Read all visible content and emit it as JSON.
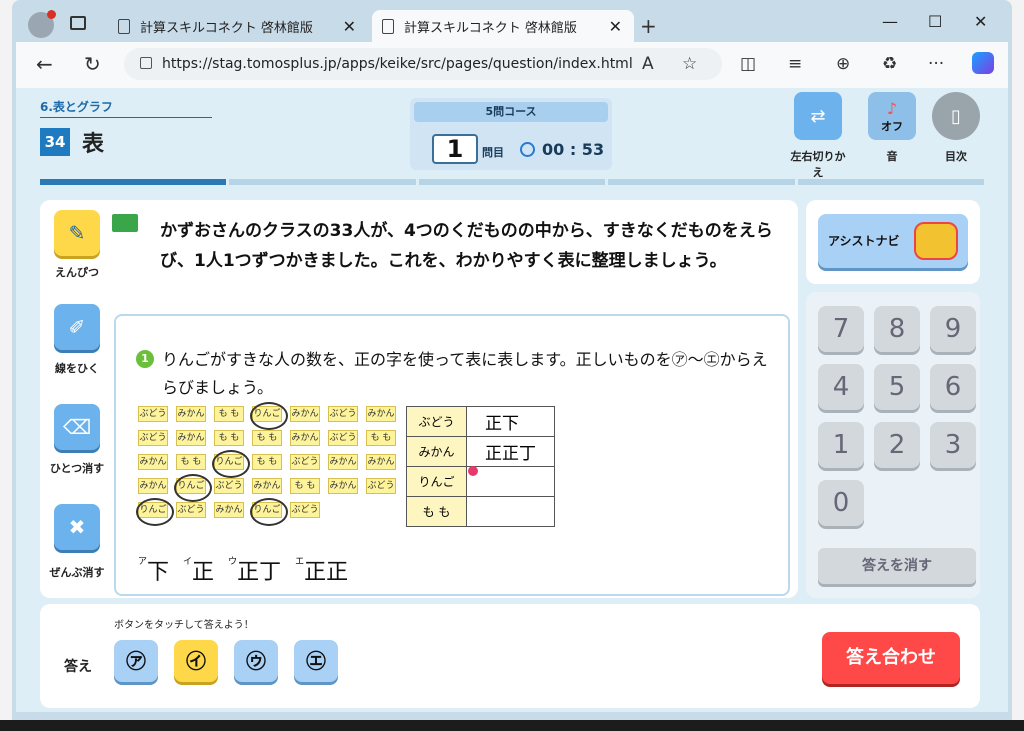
{
  "browser": {
    "tabs": [
      {
        "title": "計算スキルコネクト 啓林館版"
      },
      {
        "title": "計算スキルコネクト 啓林館版"
      }
    ],
    "new_tab": "+",
    "close_glyph": "✕",
    "window": {
      "min": "—",
      "max": "☐",
      "close": "✕"
    },
    "nav": {
      "back": "←",
      "reload": "↻"
    },
    "url": "https://stag.tomosplus.jp/apps/keike/src/pages/question/index.html",
    "toolbar_icons": [
      "read-aloud-icon",
      "favorite-icon",
      "split-screen-icon",
      "favorites-icon",
      "collections-icon",
      "extensions-icon",
      "more-icon",
      "copilot-icon"
    ],
    "toolbar_glyphs": {
      "read": "A",
      "fav": "☆",
      "split": "◫",
      "favs": "≡",
      "collections": "⊕",
      "ext": "♻",
      "more": "···"
    }
  },
  "header": {
    "unit": "6.表とグラフ",
    "lesson_num": "34",
    "lesson_title": "表",
    "course": "5問コース",
    "question_num": "1",
    "question_label": "問目",
    "timer": "00 : 53",
    "buttons": [
      {
        "label": "左右切りかえ",
        "glyph": "⇄"
      },
      {
        "label": "音",
        "sub": "オフ",
        "glyph": "♪"
      },
      {
        "label": "目次",
        "glyph": "▯"
      }
    ]
  },
  "progress": {
    "total": 5,
    "current": 1
  },
  "tools": [
    {
      "label": "えんぴつ",
      "glyph": "✎"
    },
    {
      "label": "線をひく",
      "glyph": "✐"
    },
    {
      "label": "ひとつ消す",
      "glyph": "⌫"
    },
    {
      "label": "ぜんぶ消す",
      "glyph": "✖"
    }
  ],
  "question": {
    "text": "かずおさんのクラスの33人が、4つのくだものの中から、すきなくだものをえらび、1人1つずつかきました。これを、わかりやすく表に整理しましょう。",
    "sub_num": "1",
    "sub_text": "りんごがすきな人の数を、正の字を使って表に表します。正しいものを㋐～㋓からえらびましょう。"
  },
  "cards": [
    [
      "ぶどう",
      "みかん",
      "も も",
      "りんご",
      "みかん",
      "ぶどう",
      "みかん"
    ],
    [
      "ぶどう",
      "みかん",
      "も も",
      "も も",
      "みかん",
      "ぶどう",
      "も も"
    ],
    [
      "みかん",
      "も も",
      "りんご",
      "も も",
      "ぶどう",
      "みかん",
      "みかん"
    ],
    [
      "みかん",
      "りんご",
      "ぶどう",
      "みかん",
      "も も",
      "みかん",
      "ぶどう"
    ],
    [
      "りんご",
      "ぶどう",
      "みかん",
      "りんご",
      "ぶどう"
    ]
  ],
  "tally": [
    {
      "fruit": "ぶどう",
      "marks": "正下"
    },
    {
      "fruit": "みかん",
      "marks": "正正丁"
    },
    {
      "fruit": "りんご",
      "marks": ""
    },
    {
      "fruit": "も も",
      "marks": ""
    }
  ],
  "choices": [
    {
      "mark": "ア",
      "value": "下"
    },
    {
      "mark": "イ",
      "value": "正"
    },
    {
      "mark": "ウ",
      "value": "正丁"
    },
    {
      "mark": "エ",
      "value": "正正"
    }
  ],
  "assist": {
    "label": "アシストナビ"
  },
  "keypad": [
    "7",
    "8",
    "9",
    "4",
    "5",
    "6",
    "1",
    "2",
    "3",
    "0"
  ],
  "clear_label": "答えを消す",
  "answer": {
    "hint": "ボタンをタッチして答えよう！",
    "label": "答え",
    "options": [
      "㋐",
      "㋑",
      "㋒",
      "㋓"
    ],
    "selected": "㋑",
    "check": "答え合わせ"
  }
}
